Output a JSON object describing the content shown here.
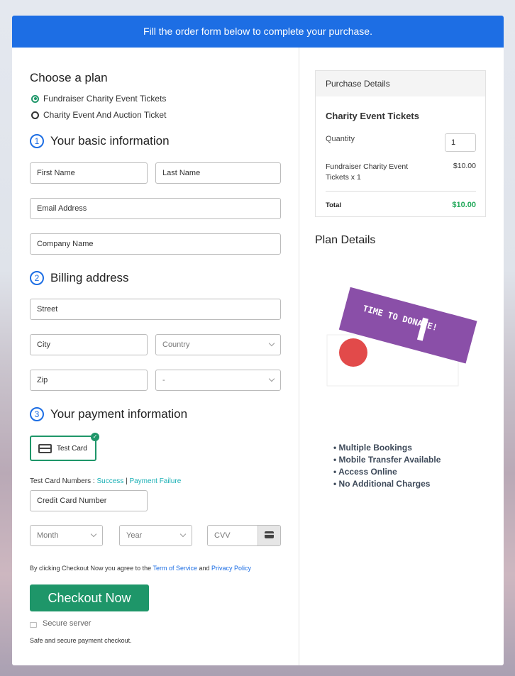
{
  "banner": "Fill the order form below to complete your purchase.",
  "plan": {
    "title": "Choose a plan",
    "options": [
      {
        "label": "Fundraiser Charity Event Tickets",
        "selected": true
      },
      {
        "label": "Charity Event And Auction Ticket",
        "selected": false
      }
    ]
  },
  "basic": {
    "num": "1",
    "title": "Your basic information",
    "first": "First Name",
    "last": "Last Name",
    "email": "Email Address",
    "company": "Company Name"
  },
  "billing": {
    "num": "2",
    "title": "Billing address",
    "street": "Street",
    "city": "City",
    "country": "Country",
    "zip": "Zip",
    "state": "-"
  },
  "payment": {
    "num": "3",
    "title": "Your payment information",
    "card_label": "Test Card",
    "test_prefix": "Test Card Numbers :",
    "success": "Success",
    "sep": "|",
    "failure": "Payment Failure",
    "cc": "Credit Card Number",
    "month": "Month",
    "year": "Year",
    "cvv": "CVV"
  },
  "agree": {
    "prefix": "By clicking Checkout Now you agree to the",
    "tos": "Term of Service",
    "and": "and",
    "privacy": "Privacy Policy"
  },
  "checkout": "Checkout Now",
  "secure": "Secure server",
  "safe": "Safe and secure payment checkout.",
  "purchase": {
    "header": "Purchase Details",
    "product": "Charity Event Tickets",
    "qty_label": "Quantity",
    "qty": "1",
    "line_item": "Fundraiser Charity Event Tickets x 1",
    "line_price": "$10.00",
    "total_label": "Total",
    "total": "$10.00"
  },
  "plan_details": {
    "title": "Plan Details",
    "image_text": "TIME TO DONATE!",
    "features": [
      "Multiple Bookings",
      "Mobile Transfer Available",
      "Access Online",
      "No Additional Charges"
    ]
  },
  "colors": {
    "brand": "#1d6ee4",
    "green": "#1e9669",
    "total": "#22a85a"
  }
}
